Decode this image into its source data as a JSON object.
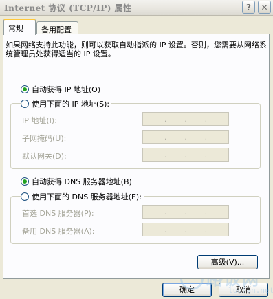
{
  "window": {
    "title": "Internet 协议 (TCP/IP) 属性",
    "help_label": "?",
    "close_label": "✕"
  },
  "tabs": [
    {
      "label": "常规"
    },
    {
      "label": "备用配置"
    }
  ],
  "description": "如果网络支持此功能，则可以获取自动指派的 IP 设置。否则，您需要从网络系统管理员处获得适当的 IP 设置。",
  "ip": {
    "auto_label": "自动获得 IP 地址(O)",
    "manual_label": "使用下面的 IP 地址(S):",
    "auto_selected": true,
    "fields": [
      {
        "label": "IP 地址(I):"
      },
      {
        "label": "子网掩码(U):"
      },
      {
        "label": "默认网关(D):"
      }
    ]
  },
  "dns": {
    "auto_label": "自动获得 DNS 服务器地址(B)",
    "manual_label": "使用下面的 DNS 服务器地址(E):",
    "auto_selected": true,
    "fields": [
      {
        "label": "首选 DNS 服务器(P):"
      },
      {
        "label": "备用 DNS 服务器(A):"
      }
    ]
  },
  "ip_separator": ".",
  "buttons": {
    "advanced": "高级(V)...",
    "ok": "确定",
    "cancel": "取消"
  },
  "watermark": {
    "main": "路饭网",
    "sub": "luofan.net"
  },
  "colors": {
    "accent_tab": "#FFC83C",
    "radio_dot": "#21A121",
    "window_bg": "#ECE9D8"
  }
}
